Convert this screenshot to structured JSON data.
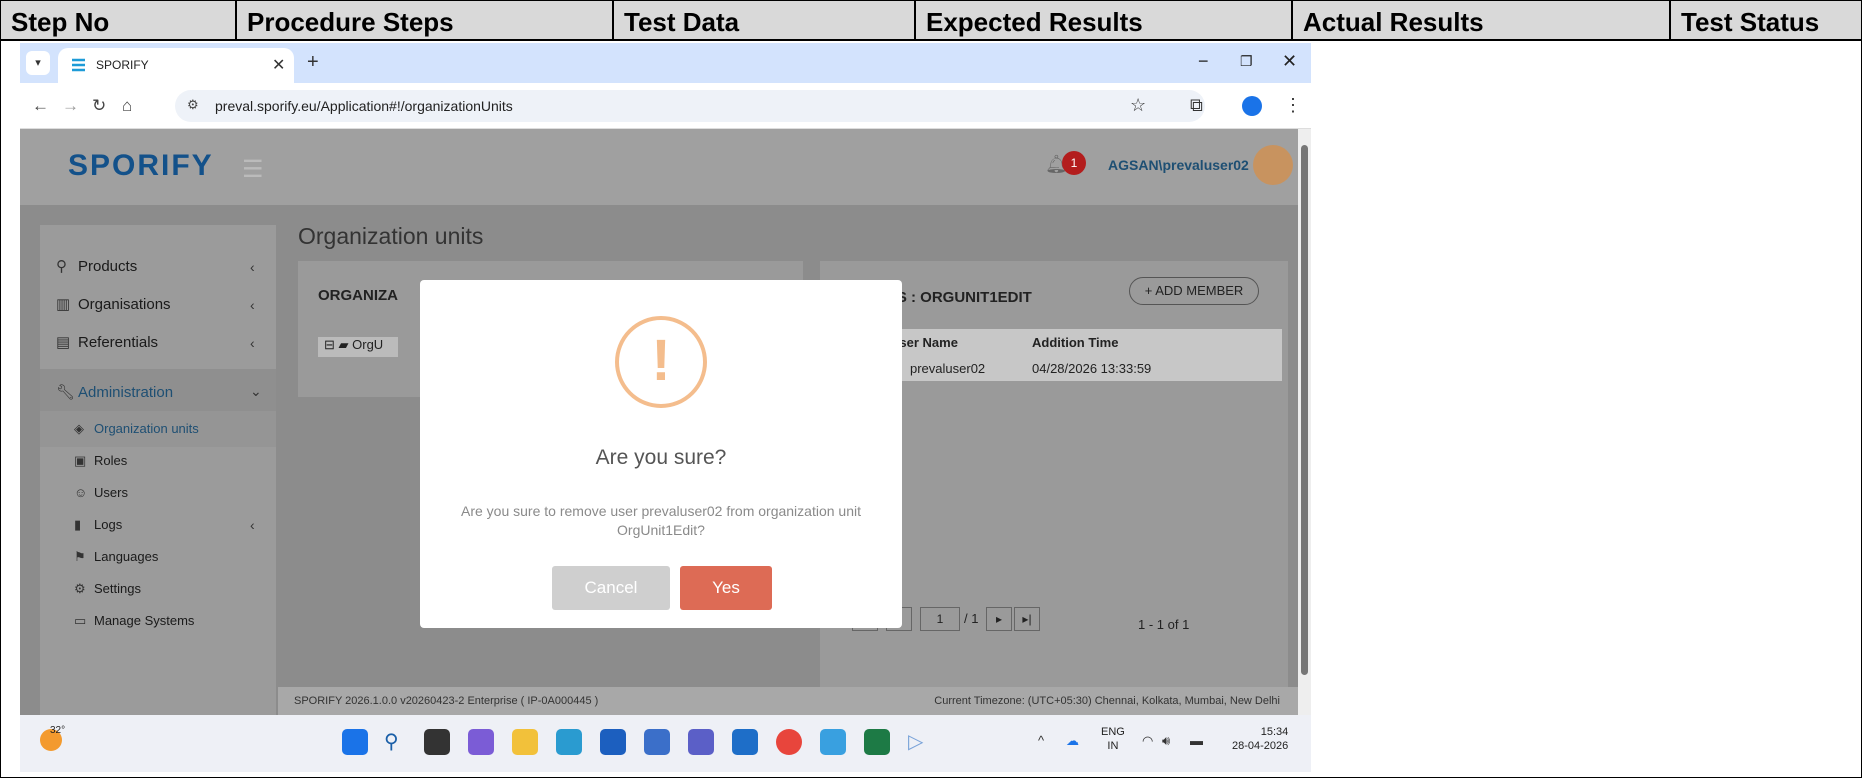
{
  "table": {
    "headers": [
      "Step No",
      "Procedure Steps",
      "Test Data",
      "Expected Results",
      "Actual Results",
      "Test Status"
    ]
  },
  "browser": {
    "tab_title": "SPORIFY",
    "url": "preval.sporify.eu/Application#!/organizationUnits"
  },
  "app": {
    "logo": "SPORIFY",
    "notification_count": "1",
    "user": "AGSAN\\prevaluser02",
    "page_title": "Organization units",
    "left_panel_title": "ORGANIZA",
    "tree_item": "OrgU",
    "right_panel_title": "RS : ORGUNIT1EDIT",
    "add_member": "ADD MEMBER",
    "grid": {
      "headers": [
        "User Name",
        "Addition Time"
      ],
      "row": [
        "prevaluser02",
        "04/28/2026 13:33:59"
      ]
    },
    "pager": {
      "page": "1",
      "of": "/ 1",
      "summary": "1 - 1 of 1"
    },
    "footer_left": "SPORIFY 2026.1.0.0 v20260423-2 Enterprise ( IP-0A000445 )",
    "footer_right": "Current Timezone: (UTC+05:30) Chennai, Kolkata, Mumbai, New Delhi",
    "sidebar": {
      "items": [
        {
          "label": "Products",
          "icon": "products-icon"
        },
        {
          "label": "Organisations",
          "icon": "org-icon"
        },
        {
          "label": "Referentials",
          "icon": "list-icon"
        },
        {
          "label": "Administration",
          "icon": "wrench-icon"
        }
      ],
      "subitems": [
        {
          "label": "Organization units",
          "icon": "layers-icon"
        },
        {
          "label": "Roles",
          "icon": "briefcase-icon"
        },
        {
          "label": "Users",
          "icon": "users-icon"
        },
        {
          "label": "Logs",
          "icon": "book-icon"
        },
        {
          "label": "Languages",
          "icon": "flag-icon"
        },
        {
          "label": "Settings",
          "icon": "gear-icon"
        },
        {
          "label": "Manage Systems",
          "icon": "monitor-icon"
        }
      ]
    }
  },
  "modal": {
    "title": "Are you sure?",
    "text": "Are you sure to remove user prevaluser02 from organization unit OrgUnit1Edit?",
    "cancel": "Cancel",
    "yes": "Yes"
  },
  "taskbar": {
    "temp": "32°",
    "lang1": "ENG",
    "lang2": "IN",
    "time": "15:34",
    "date": "28-04-2026"
  },
  "colors": {
    "accent": "#dd6b55",
    "warning": "#f4bd8d",
    "brand": "#13518a"
  }
}
